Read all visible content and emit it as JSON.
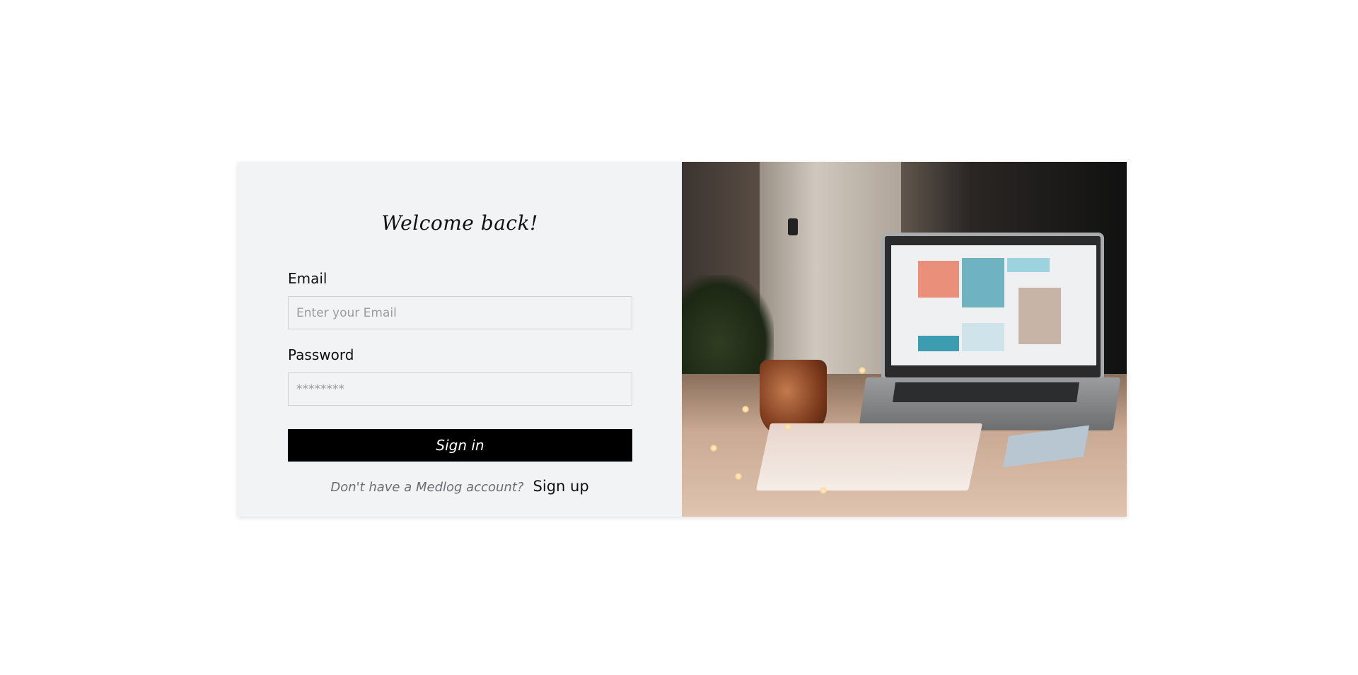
{
  "login": {
    "welcome_title": "Welcome back!",
    "email_label": "Email",
    "email_placeholder": "Enter your Email",
    "password_label": "Password",
    "password_placeholder": "********",
    "signin_button": "Sign in",
    "signup_question": "Don't have a Medlog account?",
    "signup_link": "Sign up"
  },
  "colors": {
    "panel_background": "#f2f3f5",
    "button_background": "#000000",
    "button_text": "#ffffff",
    "muted_text": "#6b6e73"
  },
  "image": {
    "icon": "laptop-desk-photo"
  }
}
